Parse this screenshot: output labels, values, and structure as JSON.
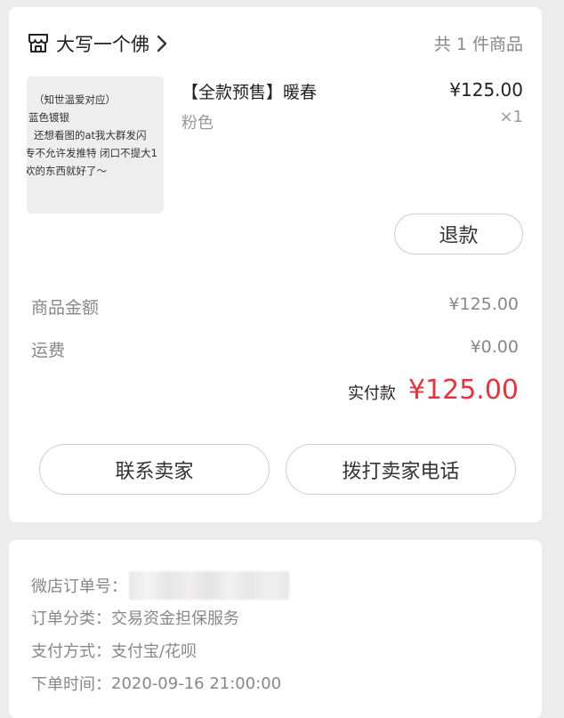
{
  "shop": {
    "name": "大写一个佛",
    "item_count": "共 1 件商品"
  },
  "product": {
    "thumbnail_text": [
      "（知世温爱对应）",
      "蓝色镀银",
      "还想看图的at我大群发闪",
      "专不允许发推特 闭口不提大1",
      "欢的东西就好了～"
    ],
    "title": "【全款预售】暖春",
    "spec": "粉色",
    "price": "¥125.00",
    "quantity": "×1",
    "refund_label": "退款"
  },
  "summary": {
    "goods_label": "商品金额",
    "goods_value": "¥125.00",
    "shipping_label": "运费",
    "shipping_value": "¥0.00",
    "paid_label": "实付款",
    "paid_value": "¥125.00"
  },
  "actions": {
    "contact_seller": "联系卖家",
    "call_seller": "拨打卖家电话"
  },
  "order_info": {
    "order_no_label": "微店订单号：",
    "category_label": "订单分类：",
    "category_value": "交易资金担保服务",
    "payment_label": "支付方式：",
    "payment_value": "支付宝/花呗",
    "time_label": "下单时间：",
    "time_value": "2020-09-16 21:00:00"
  },
  "colors": {
    "accent_price": "#e8333a",
    "background": "#ececec"
  },
  "icons": {
    "shop": "store-icon",
    "chevron": "chevron-right-icon"
  }
}
